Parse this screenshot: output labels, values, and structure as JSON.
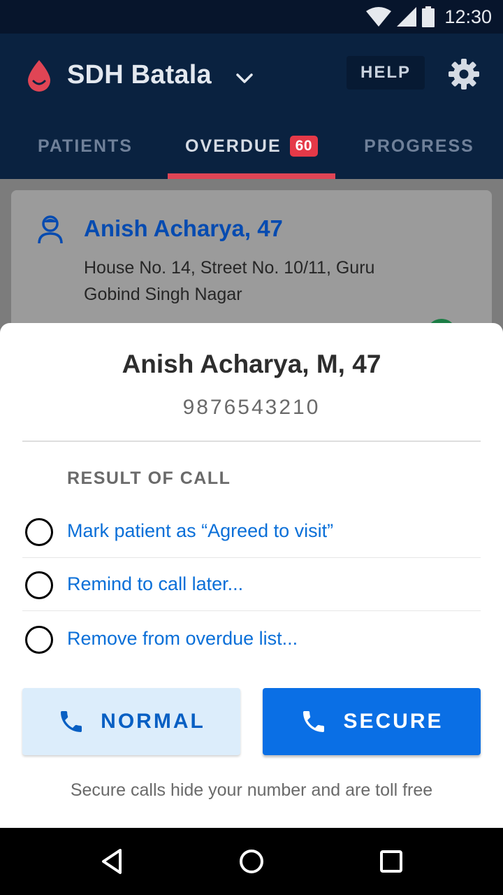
{
  "status_bar": {
    "time": "12:30"
  },
  "app_bar": {
    "facility_name": "SDH Batala",
    "help_label": "HELP"
  },
  "tabs": [
    {
      "label": "PATIENTS"
    },
    {
      "label": "OVERDUE",
      "badge": "60"
    },
    {
      "label": "PROGRESS"
    }
  ],
  "card": {
    "name": "Anish Acharya, 47",
    "address": "House No. 14, Street No. 10/11, Guru Gobind Singh Nagar"
  },
  "sheet": {
    "patient": "Anish Acharya, M, 47",
    "phone": "9876543210",
    "section_title": "RESULT OF CALL",
    "options": [
      {
        "label": "Mark patient as “Agreed to visit”",
        "color": "#17a54c"
      },
      {
        "label": "Remind to call later...",
        "color": "#f2c20f"
      },
      {
        "label": "Remove from overdue list...",
        "color": "#ec3a55"
      }
    ],
    "normal_label": "NORMAL",
    "secure_label": "SECURE",
    "footnote": "Secure calls hide your number and are toll free"
  },
  "colors": {
    "app_bar": "#0a2240",
    "accent": "#e04555",
    "primary": "#0a6fe5"
  }
}
